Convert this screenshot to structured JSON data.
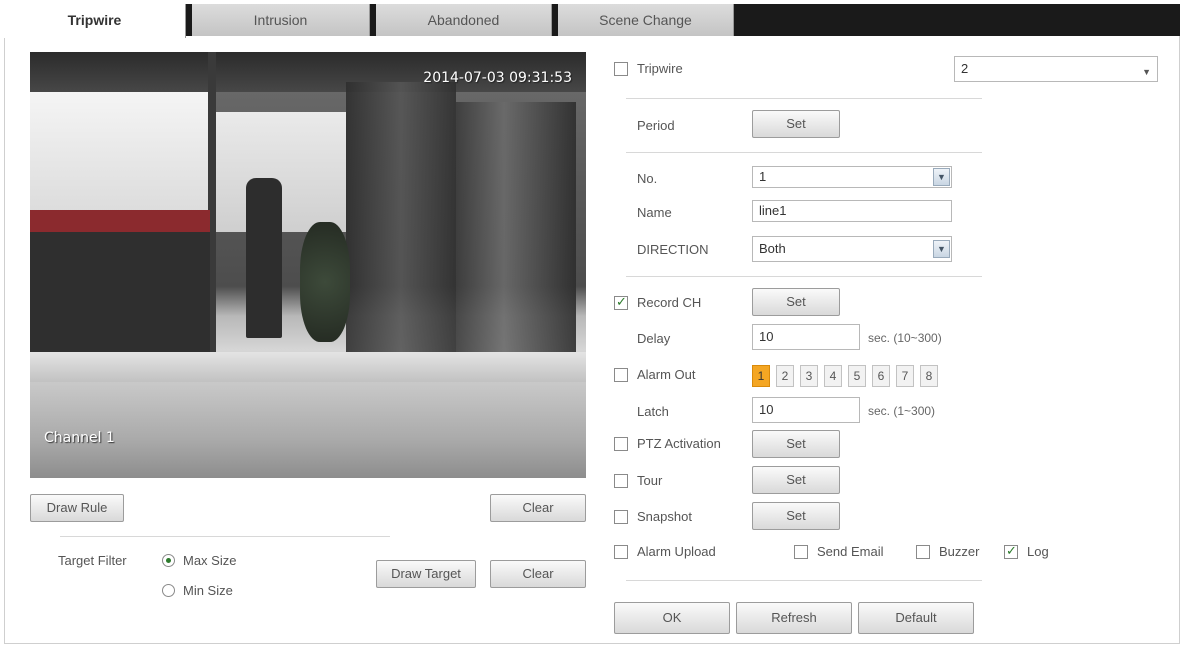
{
  "tabs": [
    {
      "label": "Tripwire",
      "active": true
    },
    {
      "label": "Intrusion",
      "active": false
    },
    {
      "label": "Abandoned",
      "active": false
    },
    {
      "label": "Scene Change",
      "active": false
    }
  ],
  "video": {
    "timestamp": "2014-07-03 09:31:53",
    "channel": "Channel 1"
  },
  "left_controls": {
    "draw_rule_label": "Draw Rule",
    "clear_label": "Clear",
    "target_filter_label": "Target Filter",
    "max_size_label": "Max Size",
    "min_size_label": "Min Size",
    "selected_size": "Max Size",
    "draw_target_label": "Draw Target",
    "clear2_label": "Clear"
  },
  "settings": {
    "tripwire": {
      "label": "Tripwire",
      "checked": false,
      "select_value": "2"
    },
    "period": {
      "label": "Period",
      "button": "Set"
    },
    "no": {
      "label": "No.",
      "value": "1"
    },
    "name": {
      "label": "Name",
      "value": "line1"
    },
    "direction": {
      "label": "DIRECTION",
      "value": "Both"
    },
    "record_ch": {
      "label": "Record CH",
      "checked": true,
      "button": "Set"
    },
    "delay": {
      "label": "Delay",
      "value": "10",
      "unit": "sec. (10~300)"
    },
    "alarm_out": {
      "label": "Alarm Out",
      "checked": false,
      "channels": [
        "1",
        "2",
        "3",
        "4",
        "5",
        "6",
        "7",
        "8"
      ],
      "active_channel": "1"
    },
    "latch": {
      "label": "Latch",
      "value": "10",
      "unit": "sec. (1~300)"
    },
    "ptz_activation": {
      "label": "PTZ Activation",
      "checked": false,
      "button": "Set"
    },
    "tour": {
      "label": "Tour",
      "checked": false,
      "button": "Set"
    },
    "snapshot": {
      "label": "Snapshot",
      "checked": false,
      "button": "Set"
    },
    "alarm_upload": {
      "label": "Alarm Upload",
      "checked": false
    },
    "send_email": {
      "label": "Send Email",
      "checked": false
    },
    "buzzer": {
      "label": "Buzzer",
      "checked": false
    },
    "log": {
      "label": "Log",
      "checked": true
    }
  },
  "footer": {
    "ok_label": "OK",
    "refresh_label": "Refresh",
    "default_label": "Default"
  },
  "colors": {
    "tabbar_bg": "#1a1a1a",
    "active_alarm_channel": "#f4a623",
    "check_mark": "#2a7a2a"
  }
}
